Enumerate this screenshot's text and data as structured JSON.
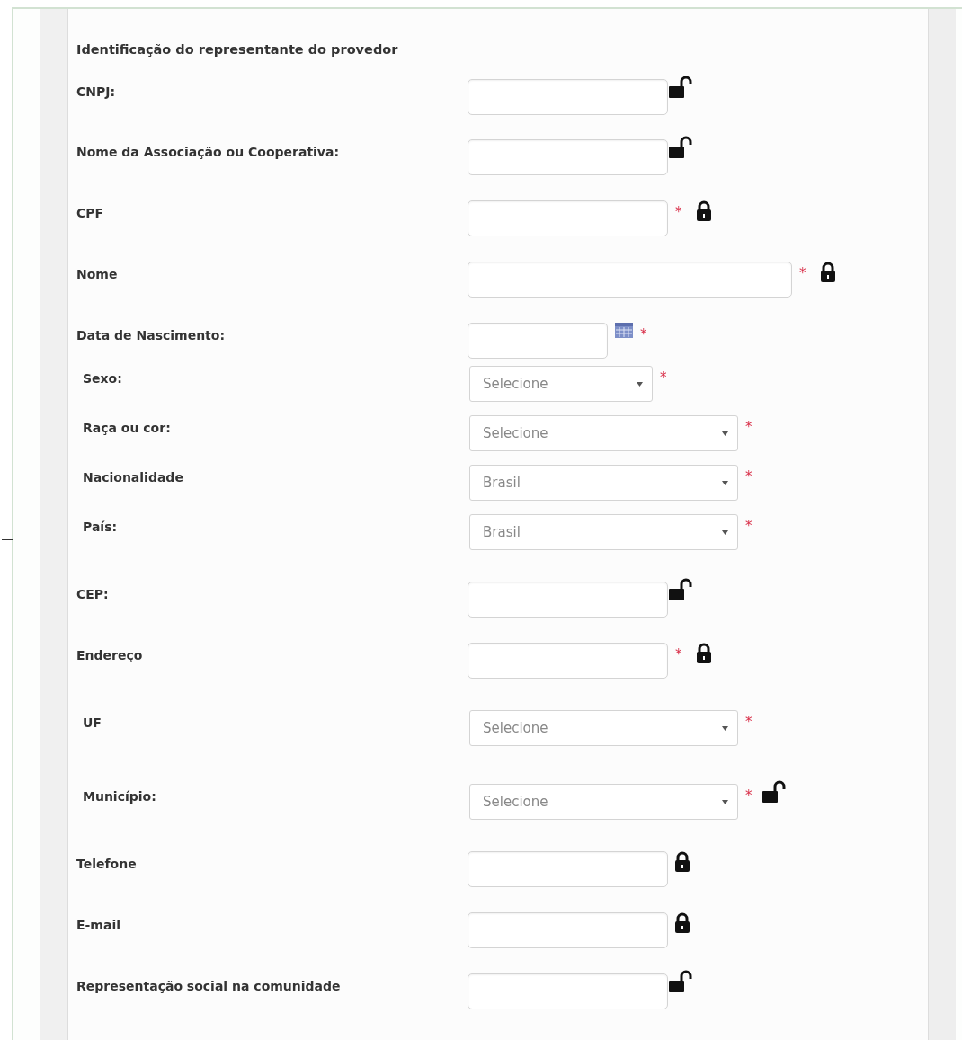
{
  "section_title": "Identificação do representante do provedor",
  "fields": [
    {
      "label": "CNPJ:",
      "kind": "text",
      "locked": false
    },
    {
      "label": "Nome da Associação ou Cooperativa:",
      "kind": "text",
      "locked": false
    },
    {
      "label": "CPF",
      "kind": "text",
      "asterisk": "*",
      "locked": true
    },
    {
      "label": "Nome",
      "kind": "longtext",
      "asterisk": "*",
      "locked": true
    },
    {
      "label": "Data de Nascimento:",
      "kind": "date",
      "asterisk": "*"
    },
    {
      "label": "Sexo:",
      "kind": "shortselect",
      "value": "Selecione",
      "asterisk": "*"
    },
    {
      "label": "Raça ou cor:",
      "kind": "select",
      "value": "Selecione",
      "asterisk": "*"
    },
    {
      "label": "Nacionalidade",
      "kind": "select",
      "value": "Brasil",
      "asterisk": "*"
    },
    {
      "label": "País:",
      "kind": "select",
      "value": "Brasil",
      "asterisk": "*"
    },
    {
      "label": "CEP:",
      "kind": "text",
      "locked": false
    },
    {
      "label": "Endereço",
      "kind": "text",
      "asterisk": "*",
      "locked": true
    },
    {
      "label": "UF",
      "kind": "select",
      "value": "Selecione",
      "asterisk": "*"
    },
    {
      "label": "Município:",
      "kind": "select",
      "value": "Selecione",
      "asterisk": "*",
      "locked": false
    },
    {
      "label": "Telefone",
      "kind": "text",
      "locked": true
    },
    {
      "label": "E-mail",
      "kind": "text",
      "locked": true
    },
    {
      "label": "Representação social na comunidade",
      "kind": "text",
      "locked": false
    }
  ]
}
